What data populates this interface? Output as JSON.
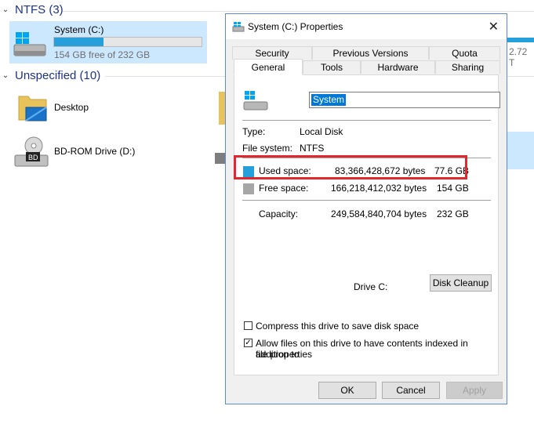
{
  "explorer": {
    "group_ntfs": "NTFS (3)",
    "group_unspecified": "Unspecified (10)",
    "drive_c": {
      "name": "System (C:)",
      "free_text": "154 GB free of 232 GB",
      "used_fraction": 0.334
    },
    "desktop_label": "Desktop",
    "bd_label": "BD-ROM Drive (D:)",
    "partial_text": "2.72 T"
  },
  "dialog": {
    "title": "System (C:) Properties",
    "tabs_row1": [
      "Security",
      "Previous Versions",
      "Quota"
    ],
    "tabs_row2": [
      "General",
      "Tools",
      "Hardware",
      "Sharing"
    ],
    "active_tab": "General",
    "drive_name_value": "System",
    "type_label": "Type:",
    "type_value": "Local Disk",
    "fs_label": "File system:",
    "fs_value": "NTFS",
    "used_label": "Used space:",
    "used_bytes": "83,366,428,672 bytes",
    "used_gb": "77.6 GB",
    "free_label": "Free space:",
    "free_bytes": "166,218,412,032 bytes",
    "free_gb": "154 GB",
    "capacity_label": "Capacity:",
    "capacity_bytes": "249,584,840,704 bytes",
    "capacity_gb": "232 GB",
    "drive_caption": "Drive C:",
    "disk_cleanup": "Disk Cleanup",
    "compress_label": "Compress this drive to save disk space",
    "index_label_1": "Allow files on this drive to have contents indexed in addition to",
    "index_label_2": "file properties",
    "compress_checked": false,
    "index_checked": true,
    "ok": "OK",
    "cancel": "Cancel",
    "apply": "Apply"
  },
  "colors": {
    "used": "#26a0da",
    "free": "#a6a6a6",
    "highlight": "#e0282e"
  }
}
